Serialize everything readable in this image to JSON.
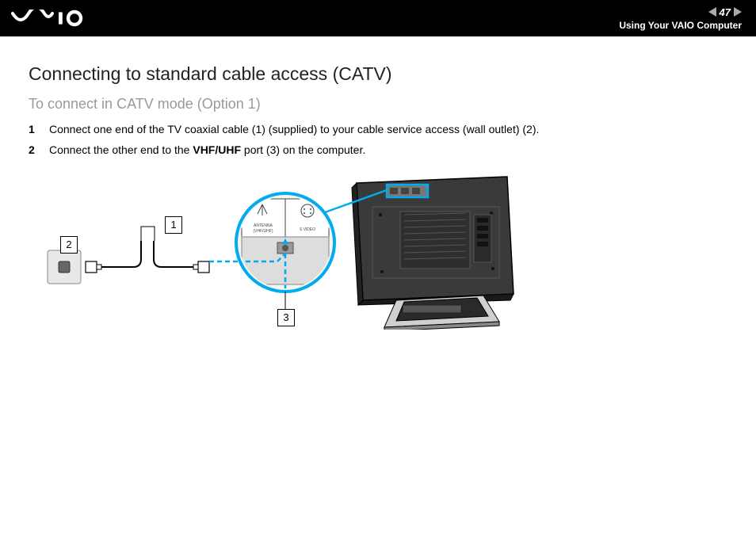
{
  "header": {
    "page_number": "47",
    "section": "Using Your VAIO Computer"
  },
  "page": {
    "heading": "Connecting to standard cable access (CATV)",
    "subheading": "To connect in CATV mode (Option 1)",
    "steps": [
      {
        "num": "1",
        "text_before": "Connect one end of the TV coaxial cable (1) (supplied) to your cable service access (wall outlet) (2).",
        "bold": "",
        "text_after": ""
      },
      {
        "num": "2",
        "text_before": "Connect the other end to the ",
        "bold": "VHF/UHF",
        "text_after": " port (3) on the computer."
      }
    ],
    "diagram": {
      "callouts": {
        "c1": "1",
        "c2": "2",
        "c3": "3"
      },
      "port_labels": {
        "antenna": "ANTENNA",
        "vhf_uhf": "(VHF/UHF)",
        "svideo": "S VIDEO"
      }
    }
  }
}
